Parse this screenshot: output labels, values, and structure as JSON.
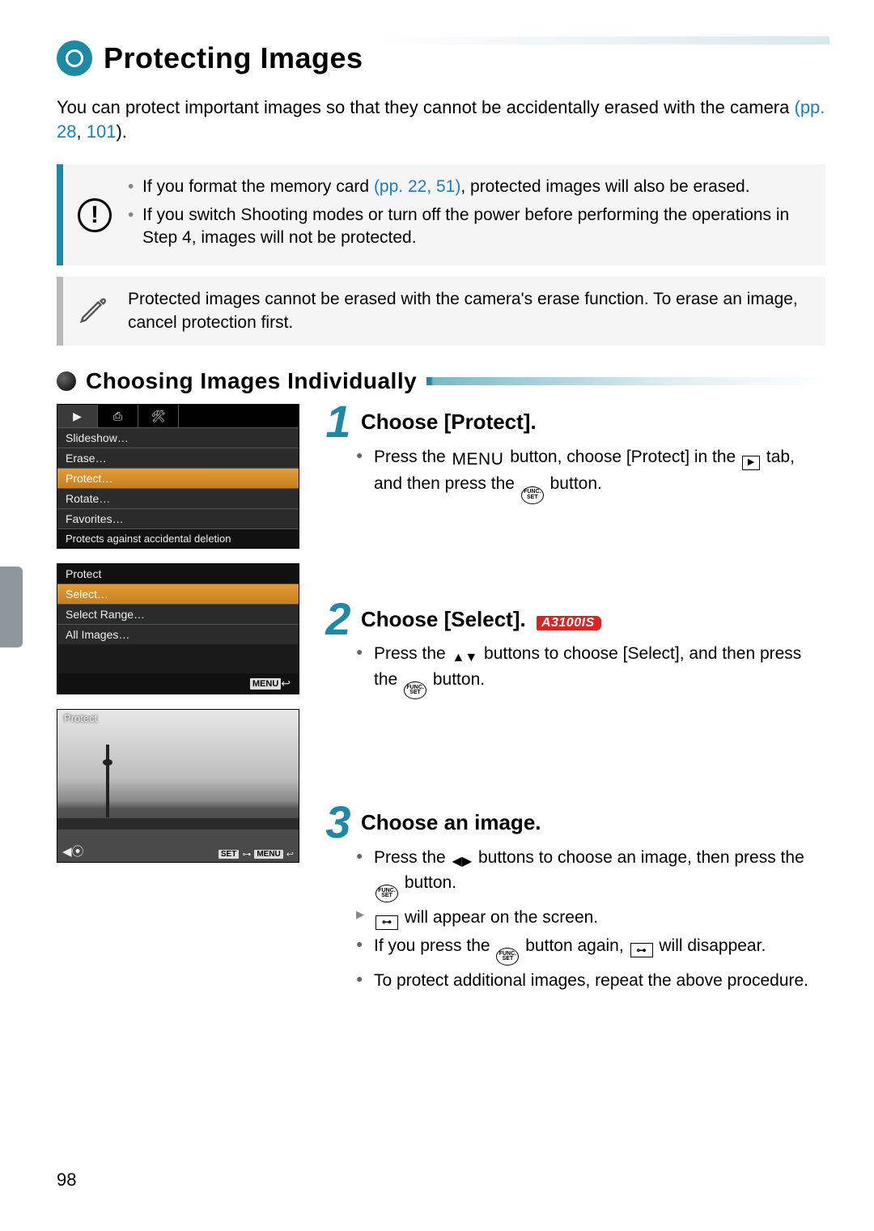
{
  "page_number": "98",
  "title": "Protecting Images",
  "intro": {
    "text_a": "You can protect important images so that they cannot be accidentally erased with the camera ",
    "link1": "(pp. 28",
    "sep": ", ",
    "link2": "101",
    "tail": ")."
  },
  "callout_warn": {
    "b1a": "If you format the memory card ",
    "b1link": "(pp. 22, 51)",
    "b1b": ", protected images will also be erased.",
    "b2": "If you switch Shooting modes or turn off the power before performing the operations in Step 4, images will not be protected."
  },
  "callout_note": "Protected images cannot be erased with the camera's erase function. To erase an image, cancel protection first.",
  "subheading": "Choosing Images Individually",
  "screen1": {
    "tabs": [
      "▶",
      "⎙",
      "🛠"
    ],
    "items": [
      "Slideshow…",
      "Erase…",
      "Protect…",
      "Rotate…",
      "Favorites…"
    ],
    "help": "Protects against accidental deletion"
  },
  "screen2": {
    "title": "Protect",
    "items": [
      "Select…",
      "Select Range…",
      "All Images…"
    ],
    "menu_label": "MENU"
  },
  "screen3": {
    "title": "Protect",
    "set": "SET",
    "menu": "MENU"
  },
  "steps": {
    "s1": {
      "num": "1",
      "title": "Choose [Protect].",
      "line_a": "Press the ",
      "menu_word": "MENU",
      "line_b": " button, choose [Protect] in the ",
      "line_c": " tab, and then press the ",
      "line_d": " button."
    },
    "s2": {
      "num": "2",
      "title": "Choose [Select]. ",
      "badge": "A3100IS",
      "line_a": "Press the ",
      "arrows": "▲▼",
      "line_b": " buttons to choose [Select], and then press the ",
      "line_c": " button."
    },
    "s3": {
      "num": "3",
      "title": "Choose an image.",
      "l1a": "Press the ",
      "l1arrows": "◀▶",
      "l1b": " buttons to choose an image, then press the ",
      "l1c": " button.",
      "l2a": " will appear on the screen.",
      "l3a": "If you press the ",
      "l3b": " button again, ",
      "l3c": " will disappear.",
      "l4": "To protect additional images, repeat the above procedure.",
      "key_icon": "⊶"
    }
  },
  "func_top": "FUNC.",
  "func_bot": "SET"
}
